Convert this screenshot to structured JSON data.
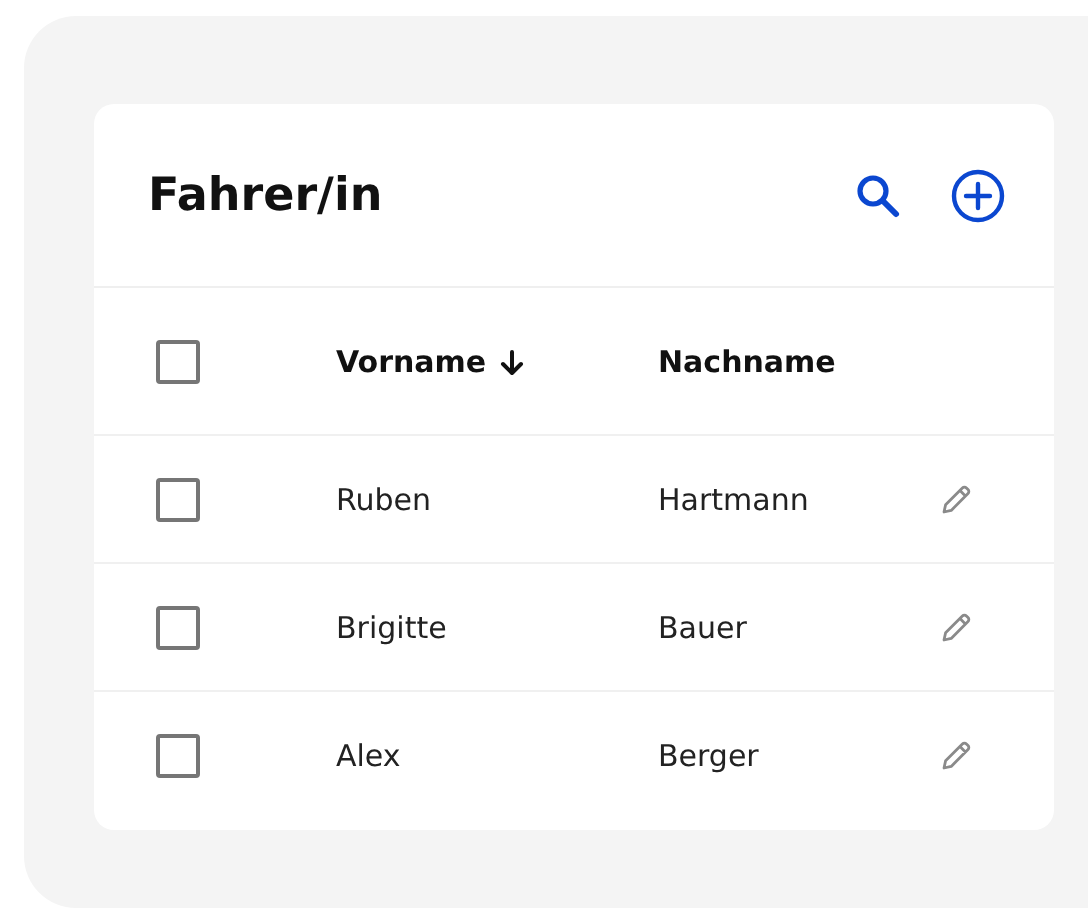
{
  "title": "Fahrer/in",
  "select_all": {
    "checked": false
  },
  "columns": [
    {
      "label": "Vorname",
      "sorted": true
    },
    {
      "label": "Nachname",
      "sorted": false
    }
  ],
  "rows": [
    {
      "first_name": "Ruben",
      "last_name": "Hartmann",
      "checked": false
    },
    {
      "first_name": "Brigitte",
      "last_name": "Bauer",
      "checked": false
    },
    {
      "first_name": "Alex",
      "last_name": "Berger",
      "checked": false
    }
  ]
}
